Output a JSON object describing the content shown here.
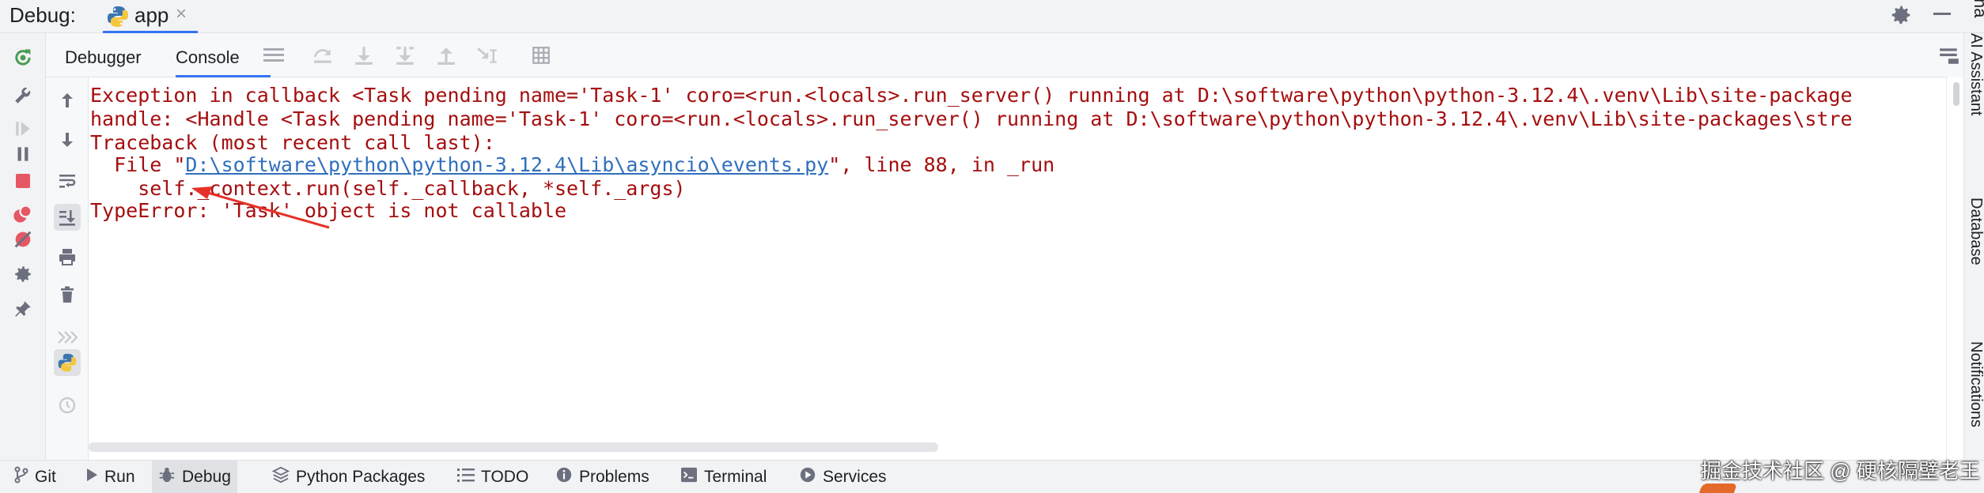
{
  "titlebar": {
    "label": "Debug:",
    "app_tab": "app",
    "close_glyph": "×",
    "right_edge_text": "na"
  },
  "tabs": {
    "debugger": "Debugger",
    "console": "Console"
  },
  "console_lines": [
    "Exception in callback <Task pending name='Task-1' coro=<run.<locals>.run_server() running at D:\\software\\python\\python-3.12.4\\.venv\\Lib\\site-package",
    "handle: <Handle <Task pending name='Task-1' coro=<run.<locals>.run_server() running at D:\\software\\python\\python-3.12.4\\.venv\\Lib\\site-packages\\stre",
    "Traceback (most recent call last):",
    "    self._context.run(self._callback, *self._args)",
    "TypeError: 'Task' object is not callable"
  ],
  "file_line": {
    "prefix": "  File \"",
    "link": "D:\\software\\python\\python-3.12.4\\Lib\\asyncio\\events.py",
    "suffix": "\", line 88, in _run"
  },
  "right_strip": {
    "ai_assistant": "AI Assistant",
    "database": "Database",
    "notifications": "Notifications"
  },
  "statusbar": {
    "git": "Git",
    "run": "Run",
    "debug": "Debug",
    "python_packages": "Python Packages",
    "todo": "TODO",
    "problems": "Problems",
    "terminal": "Terminal",
    "services": "Services"
  },
  "watermark": "掘金技术社区 @ 硬核隔壁老王",
  "colors": {
    "accent": "#3574f0",
    "error_text": "#a50e0e",
    "link": "#2f6fbd",
    "arrow": "#e8302a"
  }
}
